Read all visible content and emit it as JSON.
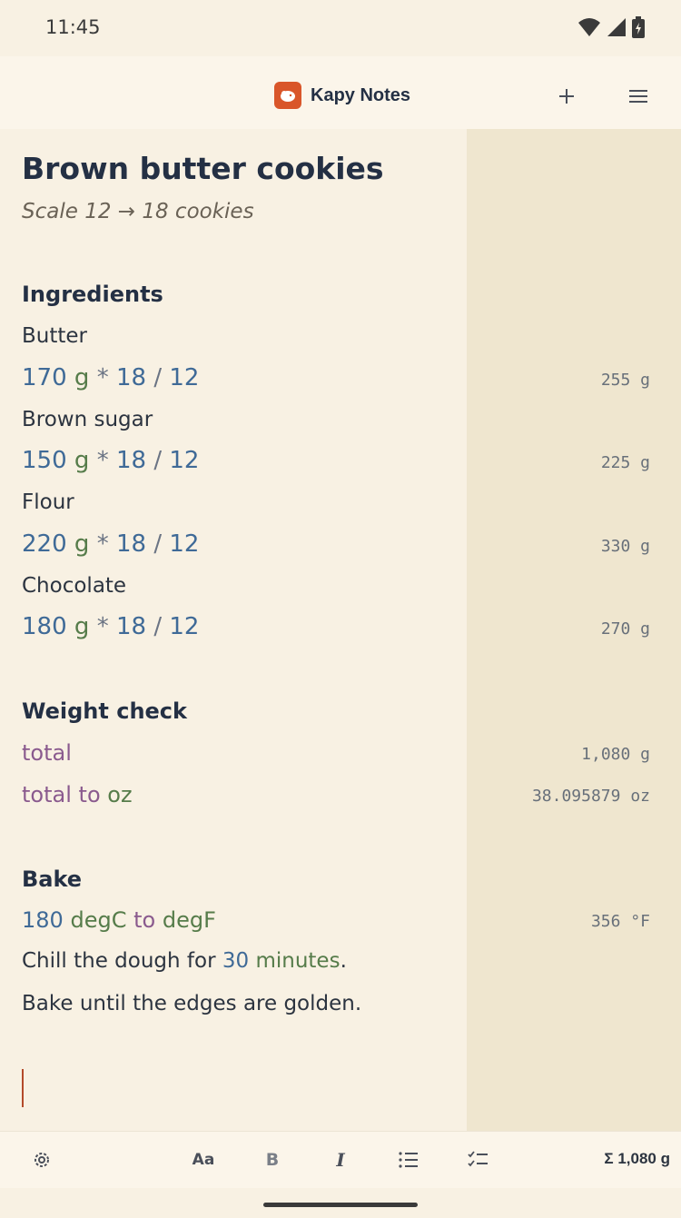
{
  "status_bar": {
    "time": "11:45"
  },
  "header": {
    "app_title": "Kapy Notes"
  },
  "note": {
    "title": "Brown butter cookies",
    "subtitle": "Scale 12 → 18 cookies",
    "sections": {
      "ingredients": {
        "heading": "Ingredients",
        "items": [
          {
            "name": "Butter",
            "amount": "170",
            "unit": "g",
            "op1": "*",
            "factor": "18",
            "op2": "/",
            "divisor": "12",
            "result": "255  g"
          },
          {
            "name": "Brown sugar",
            "amount": "150",
            "unit": "g",
            "op1": "*",
            "factor": "18",
            "op2": "/",
            "divisor": "12",
            "result": "225  g"
          },
          {
            "name": "Flour",
            "amount": "220",
            "unit": "g",
            "op1": "*",
            "factor": "18",
            "op2": "/",
            "divisor": "12",
            "result": "330  g"
          },
          {
            "name": "Chocolate",
            "amount": "180",
            "unit": "g",
            "op1": "*",
            "factor": "18",
            "op2": "/",
            "divisor": "12",
            "result": "270  g"
          }
        ]
      },
      "weight_check": {
        "heading": "Weight check",
        "total_label": "total",
        "total_result": "1,080  g",
        "to_oz_var": "total",
        "to_oz_kw": "to",
        "to_oz_unit": "oz",
        "to_oz_result": "38.095879  oz"
      },
      "bake": {
        "heading": "Bake",
        "temp_value": "180",
        "temp_unit": "degC",
        "temp_kw": "to",
        "temp_target": "degF",
        "temp_result": "356  °F",
        "chill_prefix": "Chill the dough for",
        "chill_value": "30",
        "chill_unit": "minutes",
        "chill_suffix": ".",
        "bake_line": "Bake until the edges are golden."
      }
    }
  },
  "toolbar": {
    "font_label": "Aa",
    "bold_label": "B",
    "italic_label": "I",
    "sum": "Σ 1,080 g"
  },
  "colors": {
    "accent": "#d9562a",
    "number": "#3f6a97",
    "unit": "#567c4a",
    "variable": "#8a5a8e",
    "results_panel": "#efe6cf"
  }
}
